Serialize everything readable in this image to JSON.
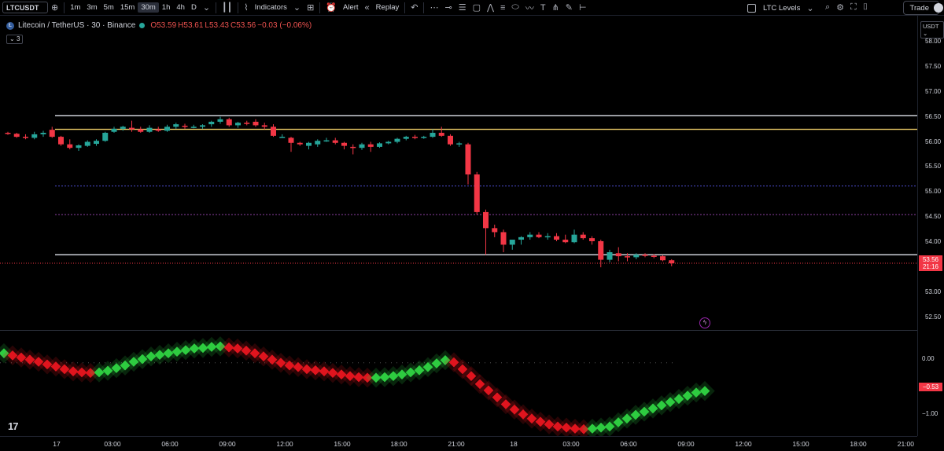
{
  "toolbar": {
    "symbol": "LTCUSDT",
    "timeframes": [
      "1m",
      "3m",
      "5m",
      "15m",
      "30m",
      "1h",
      "4h",
      "D"
    ],
    "active_timeframe": "30m",
    "indicators_label": "Indicators",
    "alert_label": "Alert",
    "replay_label": "Replay",
    "layout_name": "LTC Levels",
    "trade_label": "Trade"
  },
  "legend": {
    "title": "Litecoin / TetherUS · 30 · Binance",
    "open": "O53.59",
    "high": "H53.61",
    "low": "L53.43",
    "close": "C53.56",
    "change": "−0.03 (−0.06%)",
    "collapse": "3"
  },
  "price_scale": {
    "currency": "USDT",
    "labels": [
      "58.00",
      "57.50",
      "57.00",
      "56.50",
      "56.00",
      "55.50",
      "55.00",
      "54.50",
      "54.00",
      "53.50",
      "53.00",
      "52.50"
    ],
    "last_price": "53.56",
    "countdown": "21:16"
  },
  "oscillator_scale": {
    "labels": [
      "0.00",
      "−1.00"
    ],
    "current_value": "−0.53"
  },
  "time_axis": {
    "labels": [
      "17",
      "03:00",
      "06:00",
      "09:00",
      "12:00",
      "15:00",
      "18:00",
      "21:00",
      "18",
      "03:00",
      "06:00",
      "09:00",
      "12:00",
      "15:00",
      "18:00",
      "21:00"
    ]
  },
  "colors": {
    "up": "#26a69a",
    "down": "#f23645",
    "osc_bull": "#2ecc40",
    "osc_bear": "#e0141e",
    "level_yellow": "#f5d36b"
  },
  "chart_data": {
    "type": "candlestick",
    "symbol": "Litecoin / TetherUS",
    "interval": "30",
    "ylim": [
      52.25,
      58.2
    ],
    "levels": [
      56.52,
      56.25,
      53.75
    ],
    "dotted_levels": [
      55.12,
      54.55
    ],
    "candles": [
      {
        "o": 56.18,
        "h": 56.2,
        "l": 56.14,
        "c": 56.16
      },
      {
        "o": 56.16,
        "h": 56.18,
        "l": 56.08,
        "c": 56.1
      },
      {
        "o": 56.1,
        "h": 56.15,
        "l": 56.05,
        "c": 56.08
      },
      {
        "o": 56.08,
        "h": 56.2,
        "l": 56.05,
        "c": 56.15
      },
      {
        "o": 56.15,
        "h": 56.22,
        "l": 56.1,
        "c": 56.18
      },
      {
        "o": 56.24,
        "h": 56.3,
        "l": 56.08,
        "c": 56.1
      },
      {
        "o": 56.1,
        "h": 56.12,
        "l": 55.92,
        "c": 55.95
      },
      {
        "o": 55.95,
        "h": 56.05,
        "l": 55.85,
        "c": 55.88
      },
      {
        "o": 55.88,
        "h": 55.95,
        "l": 55.82,
        "c": 55.93
      },
      {
        "o": 55.92,
        "h": 56.03,
        "l": 55.9,
        "c": 56.0
      },
      {
        "o": 55.96,
        "h": 56.05,
        "l": 55.92,
        "c": 56.02
      },
      {
        "o": 56.02,
        "h": 56.2,
        "l": 56.0,
        "c": 56.18
      },
      {
        "o": 56.2,
        "h": 56.3,
        "l": 56.18,
        "c": 56.26
      },
      {
        "o": 56.26,
        "h": 56.32,
        "l": 56.22,
        "c": 56.3
      },
      {
        "o": 56.28,
        "h": 56.42,
        "l": 56.2,
        "c": 56.25
      },
      {
        "o": 56.25,
        "h": 56.3,
        "l": 56.18,
        "c": 56.2
      },
      {
        "o": 56.2,
        "h": 56.33,
        "l": 56.18,
        "c": 56.28
      },
      {
        "o": 56.25,
        "h": 56.3,
        "l": 56.2,
        "c": 56.22
      },
      {
        "o": 56.22,
        "h": 56.34,
        "l": 56.2,
        "c": 56.3
      },
      {
        "o": 56.3,
        "h": 56.38,
        "l": 56.26,
        "c": 56.35
      },
      {
        "o": 56.32,
        "h": 56.36,
        "l": 56.26,
        "c": 56.3
      },
      {
        "o": 56.3,
        "h": 56.34,
        "l": 56.27,
        "c": 56.3
      },
      {
        "o": 56.3,
        "h": 56.35,
        "l": 56.26,
        "c": 56.33
      },
      {
        "o": 56.35,
        "h": 56.42,
        "l": 56.3,
        "c": 56.4
      },
      {
        "o": 56.4,
        "h": 56.5,
        "l": 56.36,
        "c": 56.45
      },
      {
        "o": 56.45,
        "h": 56.48,
        "l": 56.3,
        "c": 56.33
      },
      {
        "o": 56.33,
        "h": 56.4,
        "l": 56.28,
        "c": 56.38
      },
      {
        "o": 56.38,
        "h": 56.42,
        "l": 56.33,
        "c": 56.36
      },
      {
        "o": 56.4,
        "h": 56.45,
        "l": 56.3,
        "c": 56.33
      },
      {
        "o": 56.33,
        "h": 56.38,
        "l": 56.25,
        "c": 56.3
      },
      {
        "o": 56.3,
        "h": 56.35,
        "l": 56.1,
        "c": 56.12
      },
      {
        "o": 56.1,
        "h": 56.15,
        "l": 56.08,
        "c": 56.1
      },
      {
        "o": 56.08,
        "h": 56.1,
        "l": 55.8,
        "c": 55.98
      },
      {
        "o": 55.98,
        "h": 56.0,
        "l": 55.92,
        "c": 55.95
      },
      {
        "o": 55.92,
        "h": 56.0,
        "l": 55.85,
        "c": 55.98
      },
      {
        "o": 55.95,
        "h": 56.05,
        "l": 55.9,
        "c": 56.02
      },
      {
        "o": 56.02,
        "h": 56.08,
        "l": 56.0,
        "c": 56.03
      },
      {
        "o": 56.03,
        "h": 56.08,
        "l": 55.95,
        "c": 55.98
      },
      {
        "o": 55.98,
        "h": 56.0,
        "l": 55.85,
        "c": 55.92
      },
      {
        "o": 55.9,
        "h": 55.95,
        "l": 55.75,
        "c": 55.88
      },
      {
        "o": 55.88,
        "h": 55.98,
        "l": 55.84,
        "c": 55.95
      },
      {
        "o": 55.95,
        "h": 56.0,
        "l": 55.8,
        "c": 55.9
      },
      {
        "o": 55.9,
        "h": 55.99,
        "l": 55.88,
        "c": 55.97
      },
      {
        "o": 55.97,
        "h": 56.02,
        "l": 55.95,
        "c": 56.0
      },
      {
        "o": 56.0,
        "h": 56.08,
        "l": 55.97,
        "c": 56.06
      },
      {
        "o": 56.06,
        "h": 56.12,
        "l": 56.03,
        "c": 56.1
      },
      {
        "o": 56.1,
        "h": 56.14,
        "l": 56.05,
        "c": 56.08
      },
      {
        "o": 56.08,
        "h": 56.12,
        "l": 56.06,
        "c": 56.1
      },
      {
        "o": 56.1,
        "h": 56.25,
        "l": 56.08,
        "c": 56.18
      },
      {
        "o": 56.18,
        "h": 56.3,
        "l": 56.1,
        "c": 56.12
      },
      {
        "o": 56.12,
        "h": 56.15,
        "l": 55.92,
        "c": 55.95
      },
      {
        "o": 55.95,
        "h": 56.0,
        "l": 55.9,
        "c": 55.97
      },
      {
        "o": 55.95,
        "h": 55.98,
        "l": 55.15,
        "c": 55.35
      },
      {
        "o": 55.35,
        "h": 55.4,
        "l": 54.55,
        "c": 54.6
      },
      {
        "o": 54.6,
        "h": 54.65,
        "l": 53.75,
        "c": 54.28
      },
      {
        "o": 54.28,
        "h": 54.35,
        "l": 54.1,
        "c": 54.2
      },
      {
        "o": 54.2,
        "h": 54.25,
        "l": 53.8,
        "c": 53.95
      },
      {
        "o": 53.95,
        "h": 54.0,
        "l": 53.85,
        "c": 54.05
      },
      {
        "o": 54.05,
        "h": 54.12,
        "l": 53.95,
        "c": 54.1
      },
      {
        "o": 54.1,
        "h": 54.2,
        "l": 54.05,
        "c": 54.15
      },
      {
        "o": 54.15,
        "h": 54.2,
        "l": 54.08,
        "c": 54.1
      },
      {
        "o": 54.1,
        "h": 54.18,
        "l": 54.05,
        "c": 54.12
      },
      {
        "o": 54.12,
        "h": 54.18,
        "l": 54.02,
        "c": 54.05
      },
      {
        "o": 54.05,
        "h": 54.15,
        "l": 53.98,
        "c": 54.0
      },
      {
        "o": 54.0,
        "h": 54.25,
        "l": 53.98,
        "c": 54.15
      },
      {
        "o": 54.15,
        "h": 54.2,
        "l": 54.05,
        "c": 54.08
      },
      {
        "o": 54.08,
        "h": 54.12,
        "l": 53.95,
        "c": 54.02
      },
      {
        "o": 54.02,
        "h": 54.05,
        "l": 53.5,
        "c": 53.65
      },
      {
        "o": 53.65,
        "h": 53.85,
        "l": 53.6,
        "c": 53.8
      },
      {
        "o": 53.78,
        "h": 53.9,
        "l": 53.62,
        "c": 53.72
      },
      {
        "o": 53.72,
        "h": 53.78,
        "l": 53.62,
        "c": 53.7
      },
      {
        "o": 53.7,
        "h": 53.78,
        "l": 53.66,
        "c": 53.75
      },
      {
        "o": 53.75,
        "h": 53.78,
        "l": 53.7,
        "c": 53.73
      },
      {
        "o": 53.73,
        "h": 53.76,
        "l": 53.68,
        "c": 53.72
      },
      {
        "o": 53.72,
        "h": 53.74,
        "l": 53.62,
        "c": 53.64
      },
      {
        "o": 53.64,
        "h": 53.66,
        "l": 53.52,
        "c": 53.58
      }
    ],
    "oscillator": [
      0.18,
      0.14,
      0.1,
      0.06,
      0.02,
      -0.03,
      -0.07,
      -0.12,
      -0.16,
      -0.18,
      -0.19,
      -0.18,
      -0.15,
      -0.1,
      -0.05,
      0.02,
      0.07,
      0.12,
      0.15,
      0.18,
      0.21,
      0.24,
      0.27,
      0.28,
      0.3,
      0.31,
      0.29,
      0.27,
      0.23,
      0.18,
      0.12,
      0.06,
      0.0,
      -0.05,
      -0.08,
      -0.12,
      -0.14,
      -0.16,
      -0.19,
      -0.22,
      -0.25,
      -0.27,
      -0.28,
      -0.28,
      -0.27,
      -0.25,
      -0.22,
      -0.18,
      -0.14,
      -0.08,
      -0.01,
      0.05,
      0.01,
      -0.12,
      -0.25,
      -0.4,
      -0.52,
      -0.65,
      -0.78,
      -0.88,
      -0.97,
      -1.05,
      -1.11,
      -1.16,
      -1.2,
      -1.22,
      -1.24,
      -1.25,
      -1.24,
      -1.22,
      -1.2,
      -1.12,
      -1.05,
      -0.98,
      -0.92,
      -0.86,
      -0.8,
      -0.74,
      -0.68,
      -0.62,
      -0.56,
      -0.53
    ],
    "osc_ylim": [
      -1.35,
      0.5
    ]
  }
}
